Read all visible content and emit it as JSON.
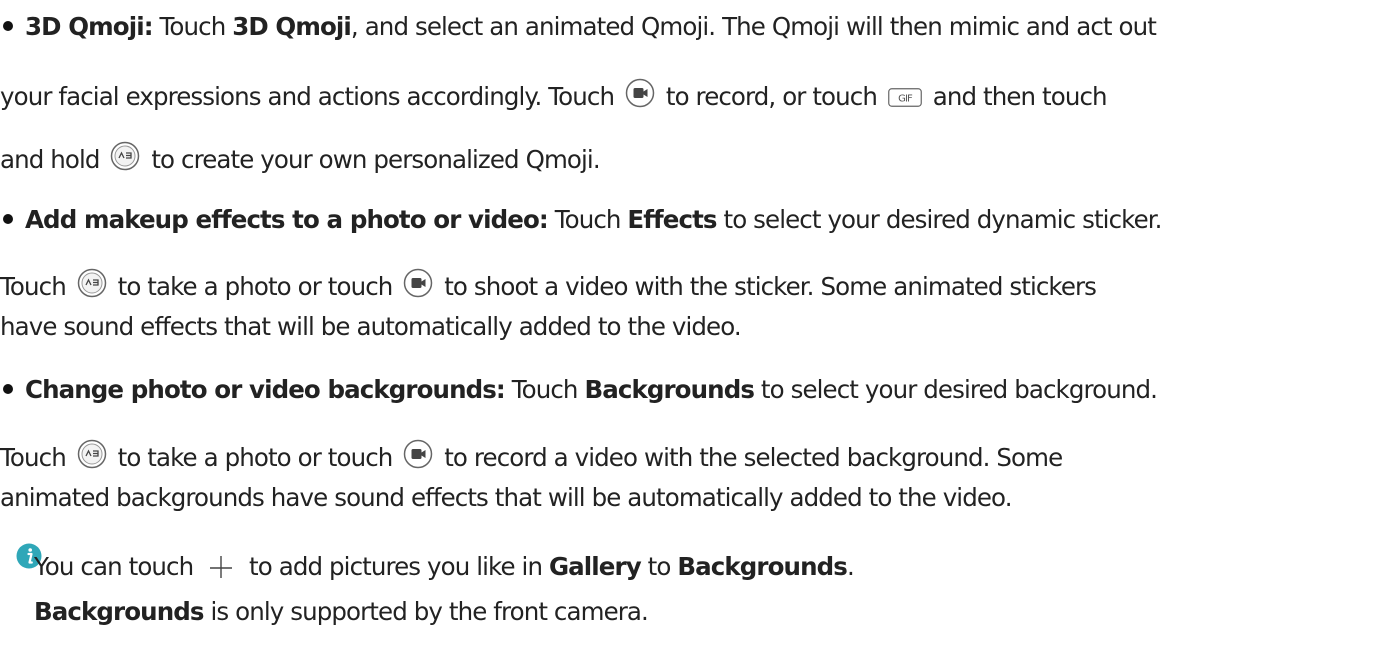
{
  "items": [
    {
      "title": "3D Qmoji:",
      "l1a": "Touch ",
      "l1b": "3D Qmoji",
      "l1c": ", and select an animated Qmoji. The Qmoji will then mimic and act out",
      "l2a": "your facial expressions and actions accordingly. Touch",
      "l2b": "to record, or touch",
      "l2c": "and then touch",
      "l3a": "and hold",
      "l3b": "to create your own personalized Qmoji."
    },
    {
      "title": "Add makeup effects to a photo or video:",
      "l1a": " Touch ",
      "l1b": "Effects",
      "l1c": " to select your desired dynamic sticker.",
      "l2a": "Touch",
      "l2b": "to take a photo or touch",
      "l2c": "to shoot a video with the sticker. Some animated stickers",
      "l3": "have sound effects that will be automatically added to the video."
    },
    {
      "title": "Change photo or video backgrounds:",
      "l1a": " Touch ",
      "l1b": "Backgrounds",
      "l1c": " to select your desired background.",
      "l2a": "Touch",
      "l2b": "to take a photo or touch",
      "l2c": "to record a video with the selected background. Some",
      "l3": "animated backgrounds have sound effects that will be automatically added to the video."
    }
  ],
  "note": {
    "l1a": "You can touch",
    "l1b": "to add pictures you like in ",
    "l1c": "Gallery",
    "l1d": " to ",
    "l1e": "Backgrounds",
    "l1f": ".",
    "l2a": "Backgrounds",
    "l2b": " is only supported by the front camera."
  },
  "icons": {
    "video": "video-camera-icon",
    "gif": "GIF",
    "ar": "ar-capture-icon",
    "plus": "plus-icon",
    "info": "info-icon"
  },
  "colors": {
    "text": "#222222",
    "icon_gray": "#666666",
    "info_teal": "#2fa7b8"
  }
}
